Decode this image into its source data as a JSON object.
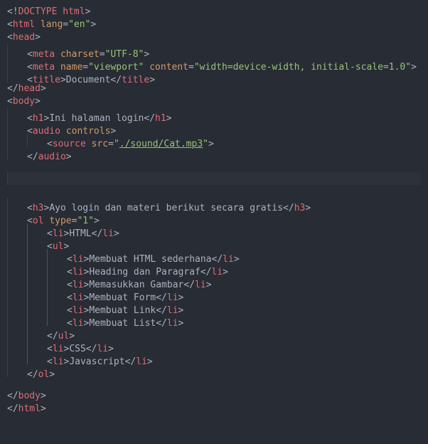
{
  "code": {
    "l01_doctype": "DOCTYPE html",
    "l02_tag": "html",
    "l02_attr": "lang",
    "l02_val": "\"en\"",
    "l03_tag": "head",
    "l04_tag": "meta",
    "l04_a1": "charset",
    "l04_v1": "\"UTF-8\"",
    "l05_tag": "meta",
    "l05_a1": "name",
    "l05_v1": "\"viewport\"",
    "l05_a2": "content",
    "l05_v2": "\"width=device-width, initial-scale=1.0\"",
    "l06_tag": "title",
    "l06_text": "Document",
    "l07_tag": "head",
    "l08_tag": "body",
    "l09_tag": "h1",
    "l09_text": "Ini halaman login",
    "l10_tag": "audio",
    "l10_a1": "controls",
    "l11_tag": "source",
    "l11_a1": "src",
    "l11_v1_open": "\"",
    "l11_v1_path": "./sound/Cat.mp3",
    "l11_v1_close": "\"",
    "l12_tag": "audio",
    "l15_tag": "h3",
    "l15_text": "Ayo login dan materi berikut secara gratis",
    "l16_tag": "ol",
    "l16_a1": "type",
    "l16_v1": "\"1\"",
    "l17_tag": "li",
    "l17_text": "HTML",
    "l18_tag": "ul",
    "l19_tag": "li",
    "l19_text": "Membuat HTML sederhana",
    "l20_tag": "li",
    "l20_text": "Heading dan Paragraf",
    "l21_tag": "li",
    "l21_text": "Memasukkan Gambar",
    "l22_tag": "li",
    "l22_text": "Membuat Form",
    "l23_tag": "li",
    "l23_text": "Membuat Link",
    "l24_tag": "li",
    "l24_text": "Membuat List",
    "l25_tag": "ul",
    "l26_tag": "li",
    "l26_text": "CSS",
    "l27_tag": "li",
    "l27_text": "Javascript",
    "l28_tag": "ol",
    "l30_tag": "body",
    "l31_tag": "html"
  }
}
